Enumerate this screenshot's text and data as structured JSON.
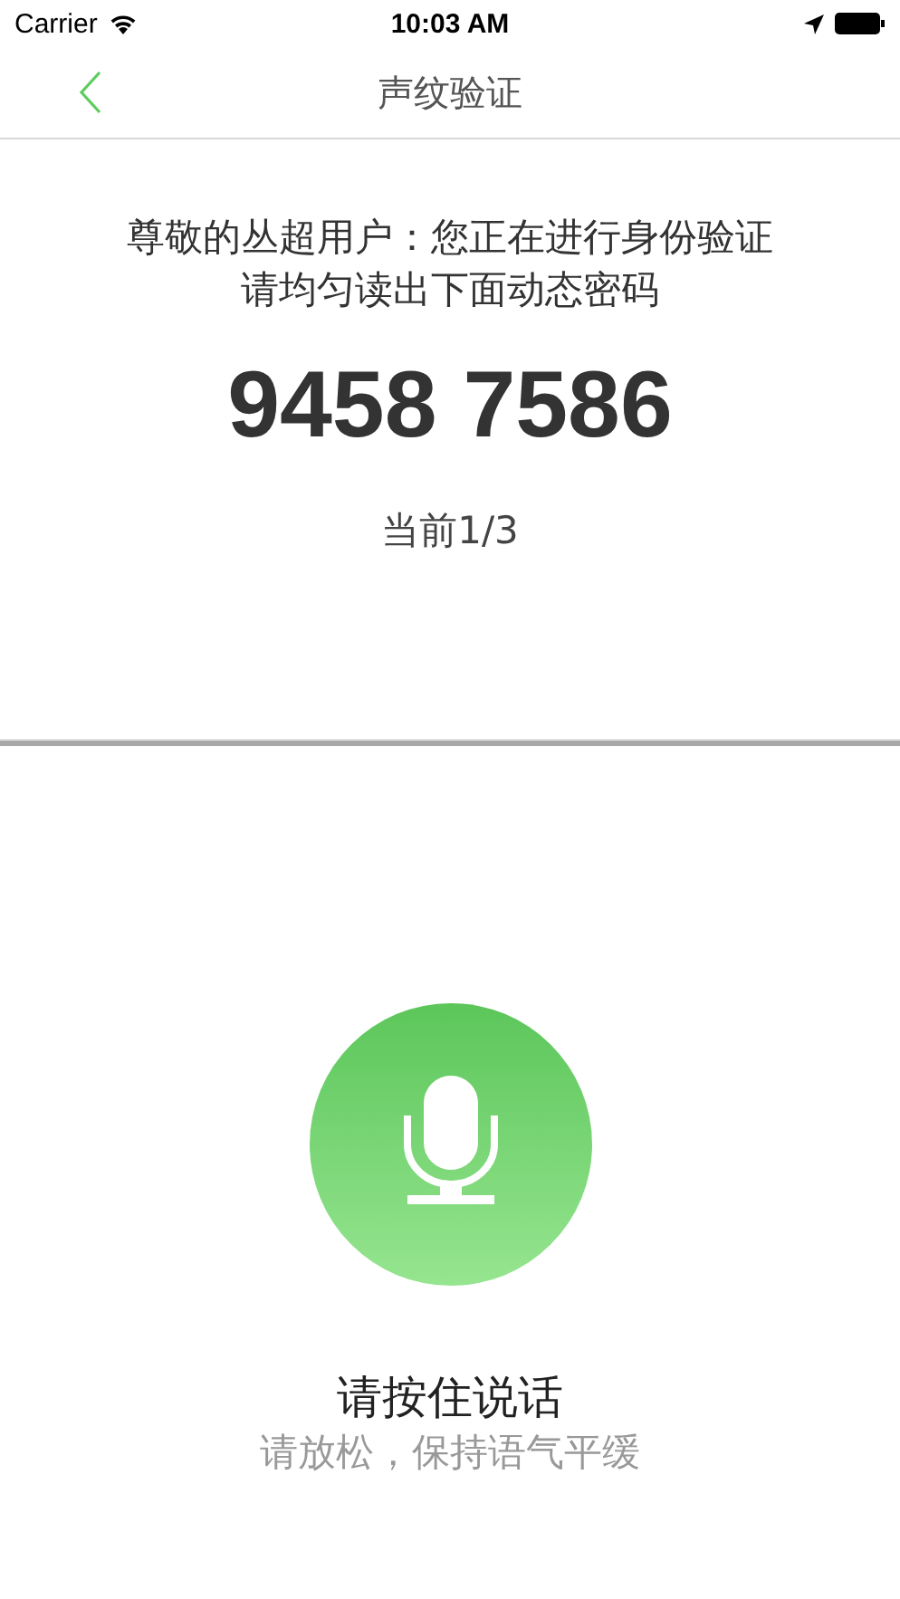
{
  "status_bar": {
    "carrier": "Carrier",
    "time": "10:03 AM"
  },
  "nav": {
    "title": "声纹验证"
  },
  "prompt": {
    "line_1": "尊敬的丛超用户：您正在进行身份验证",
    "line_2": "请均匀读出下面动态密码",
    "code": "9458 7586",
    "progress": "当前1/3"
  },
  "record": {
    "label": "请按住说话",
    "hint": "请放松，保持语气平缓"
  }
}
